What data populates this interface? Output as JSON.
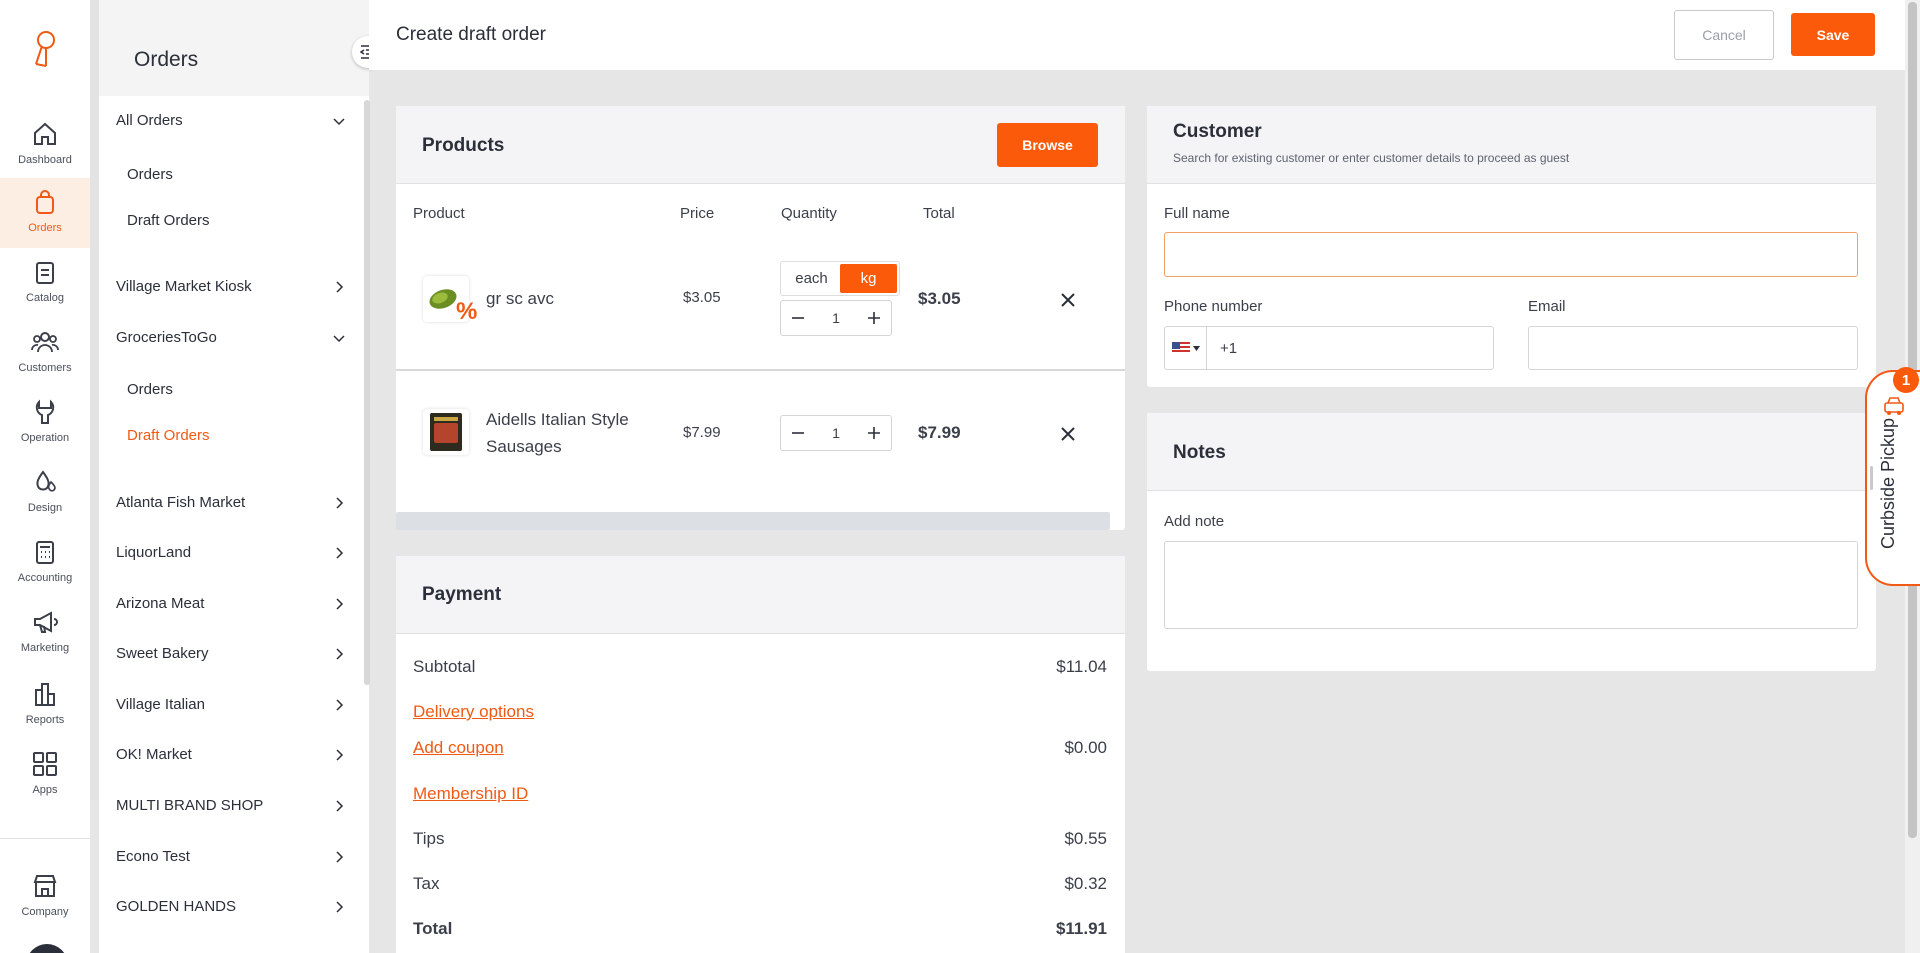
{
  "rail": {
    "items": [
      {
        "label": "Dashboard",
        "icon": "home-icon"
      },
      {
        "label": "Orders",
        "icon": "bag-icon"
      },
      {
        "label": "Catalog",
        "icon": "clipboard-icon"
      },
      {
        "label": "Customers",
        "icon": "users-icon"
      },
      {
        "label": "Operation",
        "icon": "wrench-icon"
      },
      {
        "label": "Design",
        "icon": "drops-icon"
      },
      {
        "label": "Accounting",
        "icon": "calculator-icon"
      },
      {
        "label": "Marketing",
        "icon": "megaphone-icon"
      },
      {
        "label": "Reports",
        "icon": "bar-chart-icon"
      },
      {
        "label": "Apps",
        "icon": "grid-icon"
      },
      {
        "label": "Company",
        "icon": "store-icon"
      }
    ],
    "active": "Orders",
    "accent": "#f05a14"
  },
  "subnav": {
    "title": "Orders",
    "groups": [
      {
        "label": "All Orders",
        "expanded": true,
        "children": [
          "Orders",
          "Draft Orders"
        ]
      },
      {
        "label": "Village Market Kiosk",
        "expanded": false
      },
      {
        "label": "GroceriesToGo",
        "expanded": true,
        "children": [
          "Orders",
          "Draft Orders"
        ],
        "active_child": "Draft Orders"
      },
      {
        "label": "Atlanta Fish Market",
        "expanded": false
      },
      {
        "label": "LiquorLand",
        "expanded": false
      },
      {
        "label": "Arizona Meat",
        "expanded": false
      },
      {
        "label": "Sweet Bakery",
        "expanded": false
      },
      {
        "label": "Village Italian",
        "expanded": false
      },
      {
        "label": "OK! Market",
        "expanded": false
      },
      {
        "label": "MULTI BRAND SHOP",
        "expanded": false
      },
      {
        "label": "Econo Test",
        "expanded": false
      },
      {
        "label": "GOLDEN HANDS",
        "expanded": false
      }
    ]
  },
  "header": {
    "title": "Create draft order",
    "cancel_label": "Cancel",
    "save_label": "Save"
  },
  "products": {
    "title": "Products",
    "browse_label": "Browse",
    "columns": [
      "Product",
      "Price",
      "Quantity",
      "Total"
    ],
    "rows": [
      {
        "name": "gr sc avc",
        "price": "$3.05",
        "units": [
          "each",
          "kg"
        ],
        "selected_unit": "kg",
        "qty": "1",
        "total": "$3.05",
        "badge": "%"
      },
      {
        "name": "Aidells Italian Style Sausages",
        "price": "$7.99",
        "qty": "1",
        "total": "$7.99"
      }
    ]
  },
  "payment": {
    "title": "Payment",
    "subtotal_label": "Subtotal",
    "subtotal": "$11.04",
    "delivery_label": "Delivery options",
    "coupon_label": "Add coupon",
    "coupon": "$0.00",
    "membership_label": "Membership ID",
    "tips_label": "Tips",
    "tips": "$0.55",
    "tax_label": "Tax",
    "tax": "$0.32",
    "total_label": "Total",
    "total": "$11.91"
  },
  "customer": {
    "title": "Customer",
    "subtitle": "Search for existing customer or enter customer details to proceed as guest",
    "fullname_label": "Full name",
    "fullname_value": "",
    "phone_label": "Phone number",
    "phone_value": "+1",
    "email_label": "Email",
    "email_value": ""
  },
  "notes": {
    "title": "Notes",
    "add_note_label": "Add note",
    "note_value": ""
  },
  "curbside": {
    "label": "Curbside Pickup",
    "count": "1"
  }
}
